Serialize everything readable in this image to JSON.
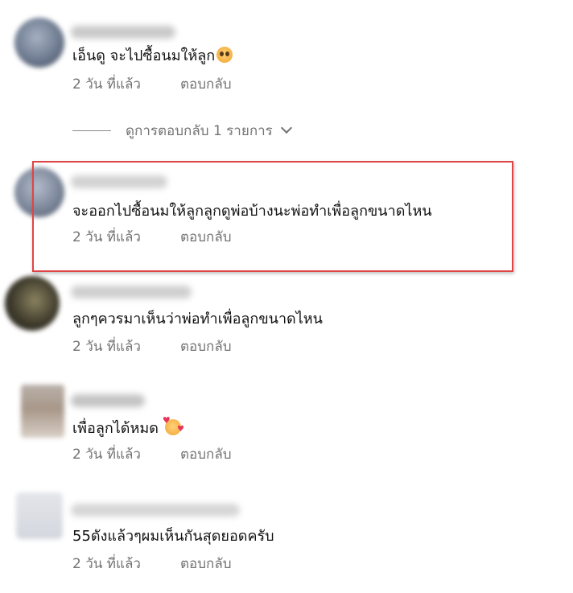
{
  "comments": [
    {
      "text": "เอ็นดู จะไปซื้อนมให้ลูก",
      "emoji": "pleading-face",
      "time": "2 วัน ที่แล้ว",
      "reply": "ตอบกลับ"
    },
    {
      "text": "จะออกไปซื้อนมให้ลูกลูกดูพ่อบ้างนะพ่อทำเพื่อลูกขนาดไหน",
      "time": "2 วัน ที่แล้ว",
      "reply": "ตอบกลับ"
    },
    {
      "text": "ลูกๆควรมาเห็นว่าพ่อทำเพื่อลูกขนาดไหน",
      "time": "2 วัน ที่แล้ว",
      "reply": "ตอบกลับ"
    },
    {
      "text": "เพื่อลูกได้หมด",
      "emoji": "smiling-face-with-hearts",
      "time": "2 วัน ที่แล้ว",
      "reply": "ตอบกลับ"
    },
    {
      "text": "55ดังแล้วๆผมเห็นกันสุดยอดครับ",
      "time": "2 วัน ที่แล้ว",
      "reply": "ตอบกลับ"
    }
  ],
  "view_replies": {
    "label": "ดูการตอบกลับ 1 รายการ",
    "icon": "chevron-down-icon"
  },
  "colors": {
    "text": "#111111",
    "meta": "#737373",
    "highlight_border": "#e04545"
  }
}
